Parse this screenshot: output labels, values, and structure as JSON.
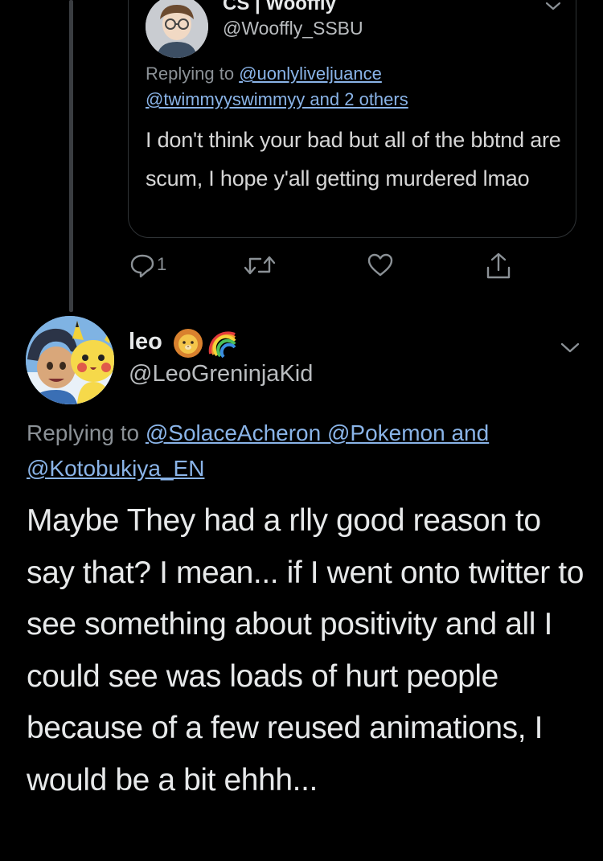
{
  "quoted_tweet": {
    "display_name": "CS | Wooffly",
    "handle": "@Wooffly_SSBU",
    "replying_prefix": "Replying to ",
    "replying_users_line1": "@uonlyliveljuance",
    "replying_users_line2": "@twimmyyswimmyy and 2 others",
    "text": "I don't think your bad but all of the bbtnd are scum, I hope y'all getting murdered lmao",
    "icons": {
      "avatar": "cartoon-avatar-with-glasses",
      "menu": "chevron-down-icon"
    }
  },
  "actions": {
    "reply_count": "1",
    "icons": [
      "reply-icon",
      "retweet-icon",
      "like-icon",
      "share-icon"
    ]
  },
  "main_tweet": {
    "display_name": "leo",
    "name_emojis": [
      "lion-face",
      "rainbow"
    ],
    "handle": "@LeoGreninjaKid",
    "replying_prefix": "Replying to ",
    "replying_users_line1": "@SolaceAcheron @Pokemon and",
    "replying_users_line2": "@Kotobukiya_EN",
    "text": "Maybe They had a rlly good reason to say that? I mean... if I went onto twitter to see something about positivity and all I could see was loads of hurt people because of a few reused animations, I would be a bit ehhh...",
    "icons": {
      "avatar": "ash-and-pikachu-avatar",
      "menu": "chevron-down-icon"
    }
  },
  "colors": {
    "background": "#000000",
    "link": "#8ab4e8",
    "secondary_text": "#8b9196",
    "primary_text": "#e7e9ea",
    "border": "#2f3336"
  }
}
